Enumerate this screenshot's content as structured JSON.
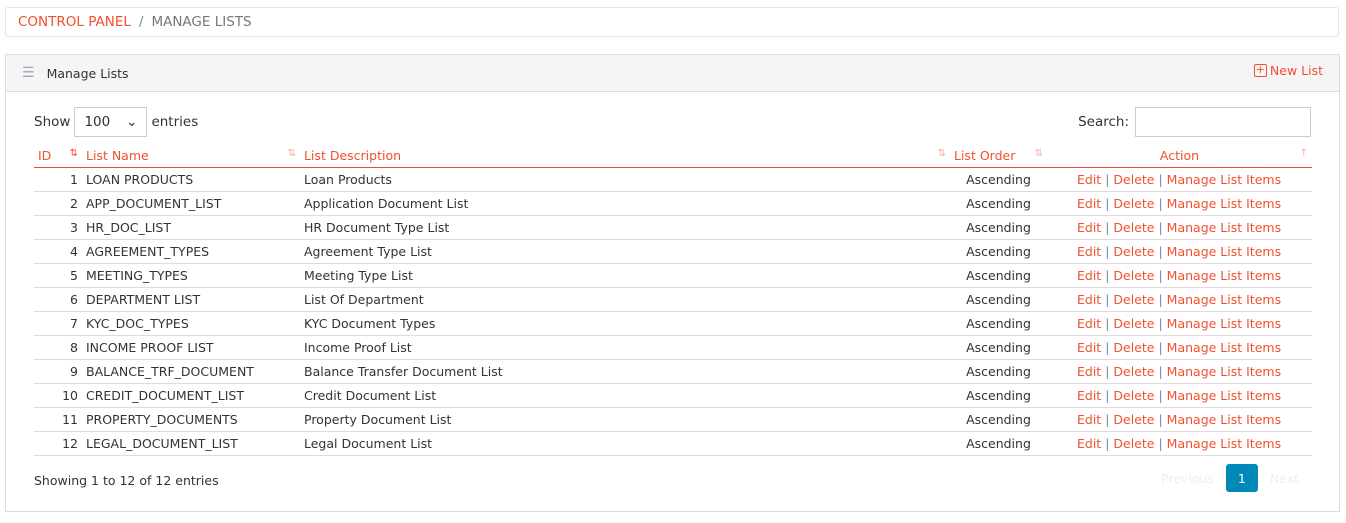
{
  "breadcrumb": {
    "root": "CONTROL PANEL",
    "separator": "/",
    "current": "MANAGE LISTS"
  },
  "panel": {
    "title": "Manage Lists",
    "new_list": "New List"
  },
  "length": {
    "show": "Show",
    "value": "100",
    "entries": "entries"
  },
  "search": {
    "label": "Search:",
    "value": ""
  },
  "columns": [
    "ID",
    "List Name",
    "List Description",
    "List Order",
    "Action"
  ],
  "rows": [
    {
      "id": "1",
      "name": "LOAN PRODUCTS",
      "desc": "Loan Products",
      "order": "Ascending"
    },
    {
      "id": "2",
      "name": "APP_DOCUMENT_LIST",
      "desc": "Application Document List",
      "order": "Ascending"
    },
    {
      "id": "3",
      "name": "HR_DOC_LIST",
      "desc": "HR Document Type List",
      "order": "Ascending"
    },
    {
      "id": "4",
      "name": "AGREEMENT_TYPES",
      "desc": "Agreement Type List",
      "order": "Ascending"
    },
    {
      "id": "5",
      "name": "MEETING_TYPES",
      "desc": "Meeting Type List",
      "order": "Ascending"
    },
    {
      "id": "6",
      "name": "DEPARTMENT LIST",
      "desc": "List Of Department",
      "order": "Ascending"
    },
    {
      "id": "7",
      "name": "KYC_DOC_TYPES",
      "desc": "KYC Document Types",
      "order": "Ascending"
    },
    {
      "id": "8",
      "name": "INCOME PROOF LIST",
      "desc": "Income Proof List",
      "order": "Ascending"
    },
    {
      "id": "9",
      "name": "BALANCE_TRF_DOCUMENT",
      "desc": "Balance Transfer Document List",
      "order": "Ascending"
    },
    {
      "id": "10",
      "name": "CREDIT_DOCUMENT_LIST",
      "desc": "Credit Document List",
      "order": "Ascending"
    },
    {
      "id": "11",
      "name": "PROPERTY_DOCUMENTS",
      "desc": "Property Document List",
      "order": "Ascending"
    },
    {
      "id": "12",
      "name": "LEGAL_DOCUMENT_LIST",
      "desc": "Legal Document List",
      "order": "Ascending"
    }
  ],
  "actions": {
    "edit": "Edit",
    "delete": "Delete",
    "manage": "Manage List Items",
    "sep": "|"
  },
  "footer": {
    "info": "Showing 1 to 12 of 12 entries",
    "previous": "Previous",
    "page": "1",
    "next": "Next"
  },
  "colors": {
    "accent": "#f0502e",
    "page_active": "#0089b9"
  }
}
